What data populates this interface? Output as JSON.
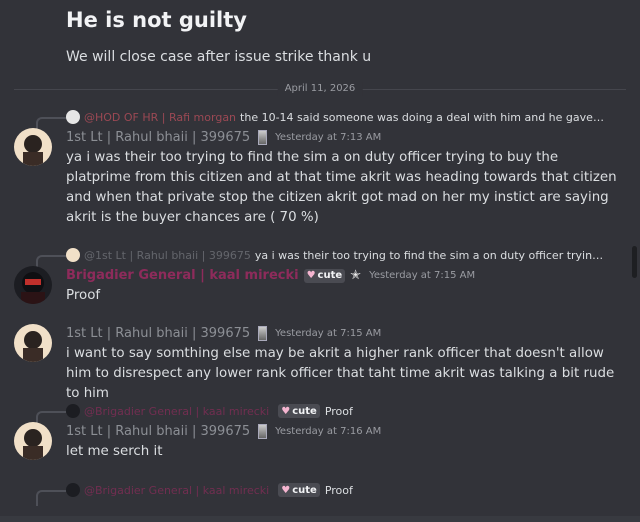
{
  "top": {
    "title": "He is not guilty",
    "line": "We will close case after issue strike thank u"
  },
  "date_divider": "April 11, 2026",
  "messages": [
    {
      "reply": {
        "name": "@HOD OF HR | Rafi morgan",
        "text": "the 10-14 said someone was doing a deal with him and he gave him ..."
      },
      "author": "1st Lt | Rahul bhaii | 399675",
      "time": "Yesterday at 7:13 AM",
      "body": "ya i was their too trying to find the sim a on duty officer trying to buy the platprime from this citizen and at that time akrit was heading towards that citizen and when that private stop the citizen akrit got mad on her my instict are saying akrit is the buyer chances are ( 70 %)"
    },
    {
      "reply": {
        "name": "@1st Lt | Rahul bhaii | 399675",
        "text": "ya i was their too trying to find the sim a on duty officer trying to ..."
      },
      "author": "Brigadier General | kaal mirecki",
      "tag": "cute",
      "time": "Yesterday at 7:15 AM",
      "body": "Proof"
    },
    {
      "author": "1st Lt | Rahul bhaii | 399675",
      "time": "Yesterday at 7:15 AM",
      "body": "i want to say somthing else may be akrit a higher rank officer that doesn't allow him to disrespect any lower rank officer that taht time akrit was talking a bit rude to him"
    },
    {
      "reply": {
        "name": "@Brigadier General | kaal mirecki",
        "tag": "cute",
        "text": "Proof"
      },
      "author": "1st Lt | Rahul bhaii | 399675",
      "time": "Yesterday at 7:16 AM",
      "body": "let me serch it"
    },
    {
      "reply": {
        "name": "@Brigadier General | kaal mirecki",
        "tag": "cute",
        "text": "Proof"
      }
    }
  ],
  "colors": {
    "background": "#323339",
    "general_name": "#a52a64"
  }
}
